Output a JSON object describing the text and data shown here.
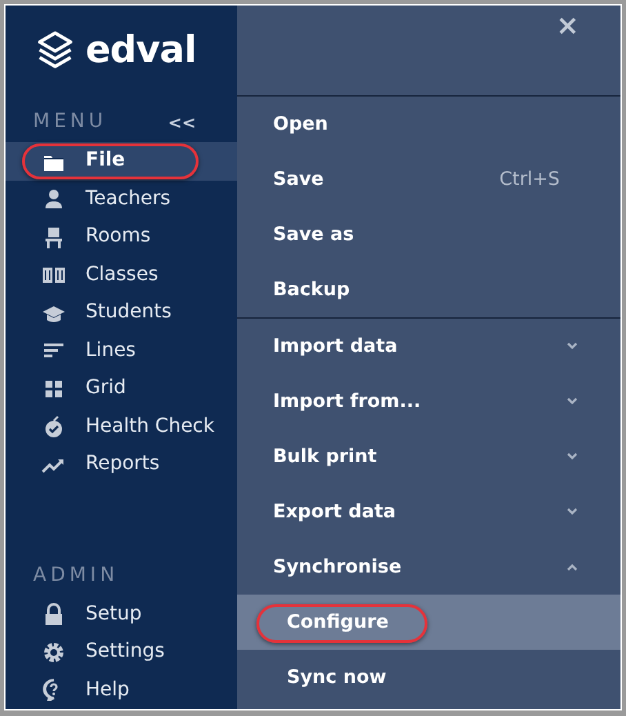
{
  "sidebar": {
    "logo": "edval",
    "menu_label": "MENU",
    "collapse": "<<",
    "items": [
      {
        "label": "File",
        "selected": true,
        "annotated": true
      },
      {
        "label": "Teachers",
        "selected": false,
        "annotated": false
      },
      {
        "label": "Rooms",
        "selected": false,
        "annotated": false
      },
      {
        "label": "Classes",
        "selected": false,
        "annotated": false
      },
      {
        "label": "Students",
        "selected": false,
        "annotated": false
      },
      {
        "label": "Lines",
        "selected": false,
        "annotated": false
      },
      {
        "label": "Grid",
        "selected": false,
        "annotated": false
      },
      {
        "label": "Health Check",
        "selected": false,
        "annotated": false
      },
      {
        "label": "Reports",
        "selected": false,
        "annotated": false
      }
    ],
    "admin_label": "ADMIN",
    "admin_items": [
      {
        "label": "Setup",
        "selected": false,
        "annotated": false
      },
      {
        "label": "Settings",
        "selected": false,
        "annotated": false
      },
      {
        "label": "Help",
        "selected": false,
        "annotated": false
      }
    ]
  },
  "file_menu": {
    "close": "×",
    "sections": [
      [
        {
          "kind": "item",
          "label": "Open"
        },
        {
          "kind": "item",
          "label": "Save",
          "shortcut": "Ctrl+S"
        },
        {
          "kind": "item",
          "label": "Save as"
        },
        {
          "kind": "item",
          "label": "Backup"
        }
      ],
      [
        {
          "kind": "submenu",
          "label": "Import data",
          "expanded": false
        },
        {
          "kind": "submenu",
          "label": "Import from...",
          "expanded": false
        },
        {
          "kind": "submenu",
          "label": "Bulk print",
          "expanded": false
        },
        {
          "kind": "submenu",
          "label": "Export data",
          "expanded": false
        },
        {
          "kind": "submenu",
          "label": "Synchronise",
          "expanded": true
        },
        {
          "kind": "subitem",
          "label": "Configure",
          "selected": true,
          "annotated": true
        },
        {
          "kind": "subitem",
          "label": "Sync now",
          "selected": false,
          "annotated": false
        }
      ]
    ]
  }
}
